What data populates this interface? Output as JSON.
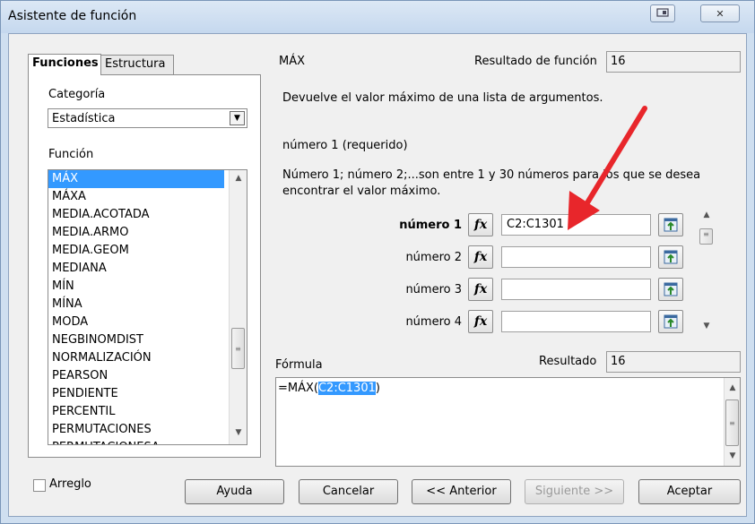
{
  "window": {
    "title": "Asistente de función",
    "close_glyph": "✕"
  },
  "tabs": {
    "functions": "Funciones",
    "structure": "Estructura"
  },
  "category": {
    "label": "Categoría",
    "value": "Estadística"
  },
  "function_list": {
    "label": "Función",
    "items": [
      "MÁX",
      "MÁXA",
      "MEDIA.ACOTADA",
      "MEDIA.ARMO",
      "MEDIA.GEOM",
      "MEDIANA",
      "MÍN",
      "MÍNA",
      "MODA",
      "NEGBINOMDIST",
      "NORMALIZACIÓN",
      "PEARSON",
      "PENDIENTE",
      "PERCENTIL",
      "PERMUTACIONES",
      "PERMUTACIONESA"
    ],
    "selected": "MÁX"
  },
  "function_info": {
    "name": "MÁX",
    "result_label": "Resultado de función",
    "result_value": "16",
    "description": "Devuelve el valor máximo de una lista de argumentos.",
    "arg_title": "número 1 (requerido)",
    "arg_description": "Número 1; número 2;...son entre 1 y 30 números para los que se desea encontrar el valor máximo."
  },
  "arguments": [
    {
      "label": "número 1",
      "value": "C2:C1301",
      "bold": true
    },
    {
      "label": "número 2",
      "value": ""
    },
    {
      "label": "número 3",
      "value": ""
    },
    {
      "label": "número 4",
      "value": ""
    }
  ],
  "fx_glyph": "fx",
  "formula": {
    "label": "Fórmula",
    "result_label": "Resultado",
    "result_value": "16",
    "prefix": "=MÁX(",
    "highlight": "C2:C1301",
    "suffix": ")"
  },
  "array_checkbox": {
    "label": "Arreglo",
    "checked": false
  },
  "buttons": {
    "help": "Ayuda",
    "cancel": "Cancelar",
    "back": "<< Anterior",
    "next": "Siguiente >>",
    "ok": "Aceptar"
  },
  "colors": {
    "selection": "#3399ff",
    "arrow": "#e8262b"
  }
}
